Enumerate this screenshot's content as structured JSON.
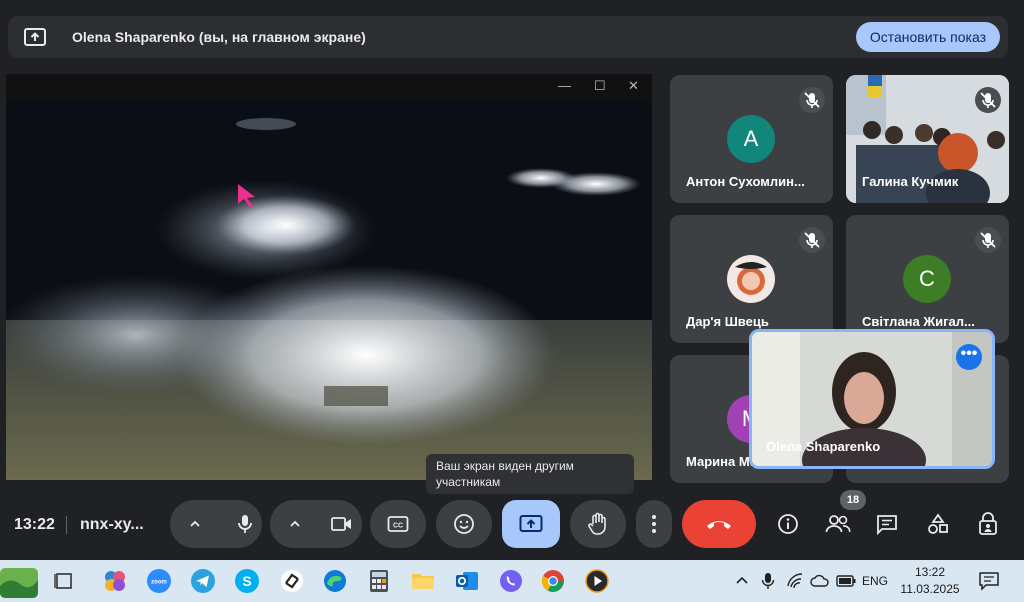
{
  "banner": {
    "presenter_text": "Olena Shaparenko (вы, на главном экране)",
    "stop_label": "Остановить показ"
  },
  "participants": [
    {
      "name": "Антон Сухомлин...",
      "initial": "А",
      "avatar_color": "#12867a"
    },
    {
      "name": "Галина Кучмик"
    },
    {
      "name": "Дар'я Швець"
    },
    {
      "name": "Світлана Жигал...",
      "initial": "С",
      "avatar_color": "#3d7d26"
    },
    {
      "name": "Марина Масл...",
      "initial": "М",
      "avatar_color": "#a142b4"
    }
  ],
  "self_view": {
    "name": "Olena Shaparenko"
  },
  "tooltip": {
    "text": "Ваш экран виден другим участникам"
  },
  "controls": {
    "time": "13:22",
    "meeting_code": "nnx-xy...",
    "people_count": "18"
  },
  "taskbar": {
    "language": "ENG",
    "time": "13:22",
    "date": "11.03.2025"
  },
  "colors": {
    "accent_blue": "#a8c7fa",
    "end_call_red": "#ea4335",
    "tile_bg": "#3c4043"
  }
}
